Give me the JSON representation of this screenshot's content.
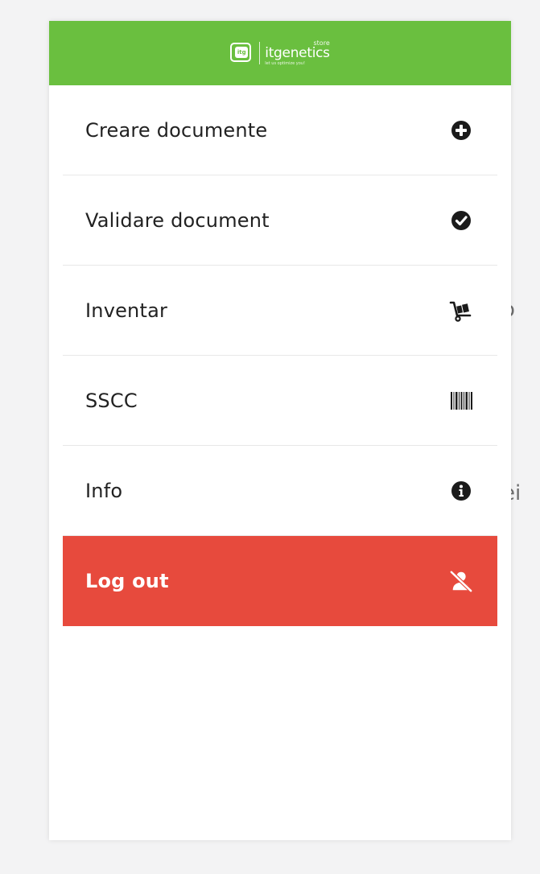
{
  "background": {
    "fragments": [
      "o",
      "ei"
    ]
  },
  "header": {
    "logo_mark": "itg",
    "logo_store": "store",
    "logo_name": "itgenetics",
    "logo_tagline": "let us optimize you!",
    "color": "#6abf3f"
  },
  "menu": {
    "items": [
      {
        "label": "Creare documente",
        "icon": "plus-circle-icon"
      },
      {
        "label": "Validare document",
        "icon": "check-circle-icon"
      },
      {
        "label": "Inventar",
        "icon": "hand-truck-icon"
      },
      {
        "label": "SSCC",
        "icon": "barcode-icon"
      },
      {
        "label": "Info",
        "icon": "info-circle-icon"
      },
      {
        "label": "Log out",
        "icon": "user-slash-icon"
      }
    ],
    "logout_color": "#e74a3d"
  }
}
